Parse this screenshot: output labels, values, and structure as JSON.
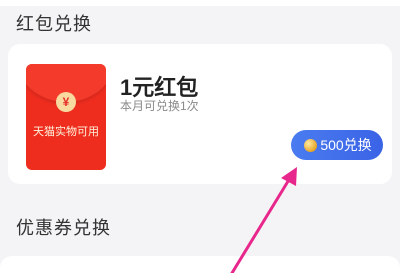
{
  "sections": {
    "redpacket_title": "红包兑换",
    "coupon_title": "优惠券兑换"
  },
  "item": {
    "name": "1元红包",
    "limit": "本月可兑换1次",
    "envelope_seal": "¥",
    "envelope_label": "天猫实物可用"
  },
  "redeem_button": {
    "label": "500兑换",
    "icon": "coin-icon"
  },
  "colors": {
    "envelope": "#ee2d1f",
    "button": "#3f6eea",
    "annotation_arrow": "#e8278c"
  }
}
